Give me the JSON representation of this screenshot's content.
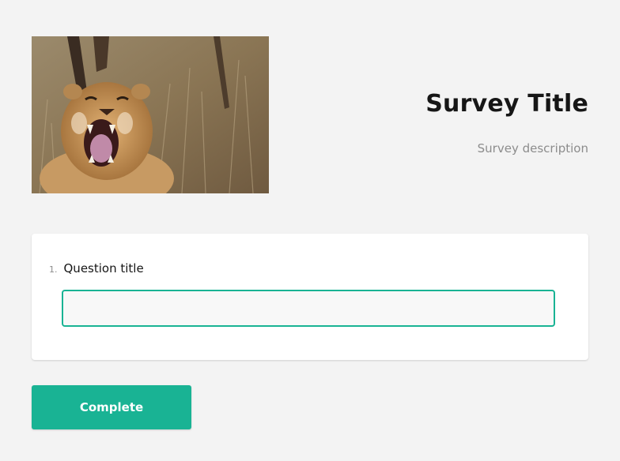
{
  "header": {
    "logo_alt": "lion image",
    "title": "Survey Title",
    "description": "Survey description"
  },
  "questions": [
    {
      "number": "1.",
      "title": "Question title",
      "value": "",
      "placeholder": ""
    }
  ],
  "navigation": {
    "complete_label": "Complete"
  },
  "colors": {
    "accent": "#19b394",
    "background": "#f3f3f3",
    "panel": "#ffffff",
    "title_text": "#161616",
    "muted_text": "#8c8c8c"
  }
}
